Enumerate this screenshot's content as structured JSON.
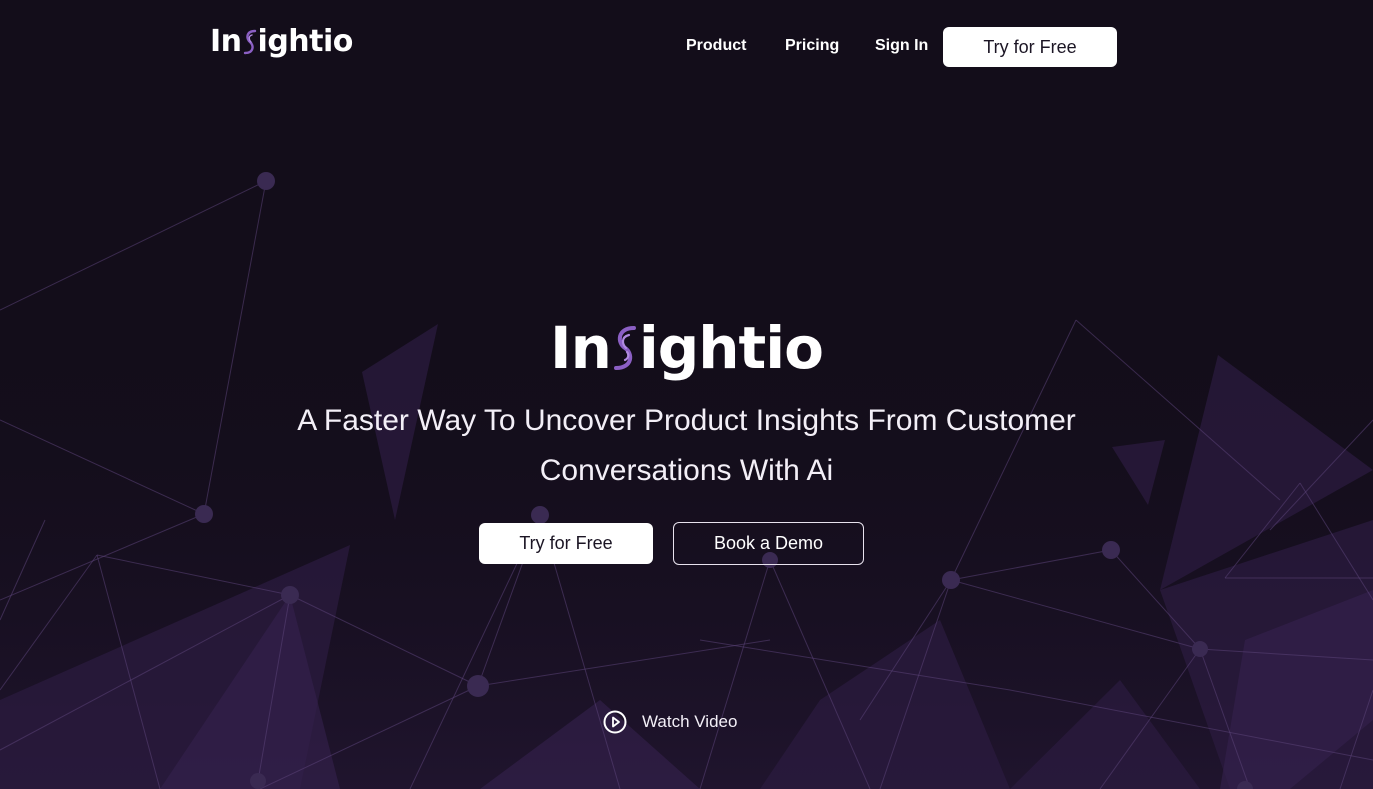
{
  "brand": {
    "name_prefix": "In",
    "name_suffix": "ightio",
    "logo_icon": "fingerprint-s-icon",
    "accent": "#8b5fc4"
  },
  "nav": {
    "links": [
      "Product",
      "Pricing",
      "Sign In"
    ],
    "cta_label": "Try for Free"
  },
  "hero": {
    "headline_line1": "A Faster Way To Uncover Product Insights From Customer",
    "headline_line2": "Conversations With Ai",
    "primary_cta": "Try for Free",
    "secondary_cta": "Book a Demo",
    "watch_video_label": "Watch Video",
    "watch_icon": "play-circle-icon"
  },
  "colors": {
    "background": "#130d1a",
    "button_bg": "#ffffff",
    "button_text": "#1b1524",
    "network_purple": "#3a2456"
  }
}
